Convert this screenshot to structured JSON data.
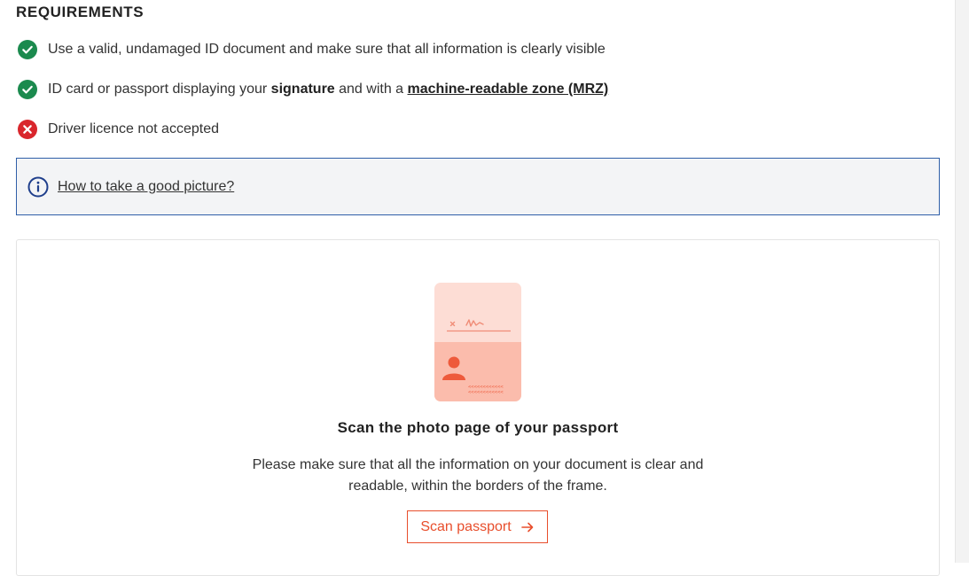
{
  "requirements": {
    "heading": "REQUIREMENTS",
    "items": [
      {
        "status": "ok",
        "icon": "check-circle-icon",
        "text": "Use a valid, undamaged ID document and make sure that all information is clearly visible"
      },
      {
        "status": "ok",
        "icon": "check-circle-icon",
        "text_before": "ID card or passport displaying your ",
        "bold": "signature",
        "text_middle": " and with a ",
        "link": "machine-readable zone (MRZ)"
      },
      {
        "status": "error",
        "icon": "x-circle-icon",
        "text": "Driver licence not accepted"
      }
    ]
  },
  "info": {
    "icon": "info-icon",
    "link": "How to take a good picture?"
  },
  "scan_card": {
    "illustration": "passport-illustration-icon",
    "title": "Scan the photo page of your passport",
    "description": "Please make sure that all the information on your document is clear and readable, within the borders of the frame.",
    "button_label": "Scan passport",
    "button_icon": "arrow-right-icon"
  },
  "colors": {
    "success": "#1b8a4e",
    "error": "#d9262c",
    "accent": "#e84e2c",
    "info_border": "#2f5fa8"
  }
}
